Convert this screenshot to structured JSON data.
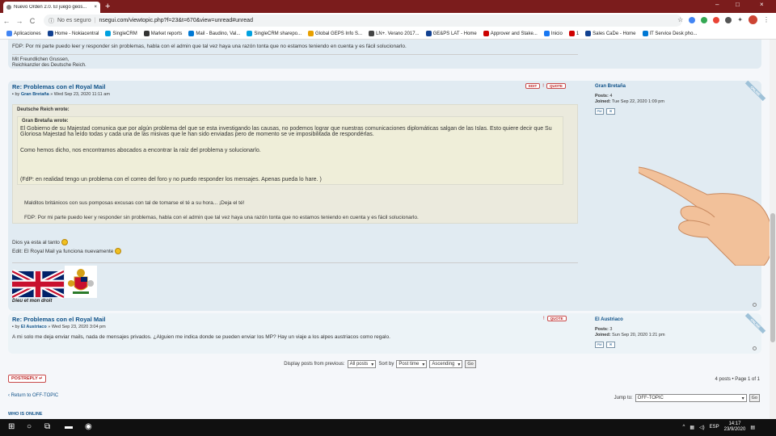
{
  "browser": {
    "tab_title": "Nuevo Orden 2.0. El juego geos...",
    "tab_close": "×",
    "new_tab": "+",
    "window_min": "–",
    "window_max": "□",
    "window_close": "×",
    "nav_back": "←",
    "nav_forward": "→",
    "nav_reload": "C",
    "security": "No es seguro",
    "url": "nsegui.com/viewtopic.php?f=23&t=670&view=unread#unread",
    "bookmarks": [
      {
        "label": "Aplicaciones",
        "color": "#4285f4"
      },
      {
        "label": "Home - Nokiacentral",
        "color": "#124191"
      },
      {
        "label": "SingleCRM",
        "color": "#00a1e0"
      },
      {
        "label": "Market reports",
        "color": "#333333"
      },
      {
        "label": "Mail - Baudino, Val...",
        "color": "#0078d4"
      },
      {
        "label": "SingleCRM sharepo...",
        "color": "#00a1e0"
      },
      {
        "label": "Global GEPS Info S...",
        "color": "#e8a000"
      },
      {
        "label": "LN+. Verano 2017...",
        "color": "#444444"
      },
      {
        "label": "GE&PS LAT - Home",
        "color": "#124191"
      },
      {
        "label": "Approver and Stake...",
        "color": "#cc0000"
      },
      {
        "label": "Inicio",
        "color": "#1877f2"
      },
      {
        "label": "1",
        "color": "#d00000"
      },
      {
        "label": "Sales CaDe - Home",
        "color": "#124191"
      },
      {
        "label": "IT Service Desk pho...",
        "color": "#0078d4"
      }
    ]
  },
  "prev_post": {
    "fdp": "FDP: Por mi parte puedo leer y responder sin problemas, habla con el admin que tal vez haya una razón tonta que no estamos teniendo en cuenta y es fácil solucionarlo.",
    "sig1": "Mit Freundlichen Grussen,",
    "sig2": "Reichkanzler des Deutsche Reich."
  },
  "post1": {
    "title": "Re: Problemas con el Royal Mail",
    "author": "Gran Bretaña",
    "author_prefix": "by",
    "date": "» Wed Sep 23, 2020 11:11 am",
    "edit_btn": "EDIT",
    "warn_icon": "!",
    "quote_btn": "QUOTE",
    "outer_cite": "Deutsche Reich wrote:",
    "inner_cite": "Gran Bretaña wrote:",
    "inner_p1": "El Gobierno de su Majestad comunica que por algún problema del que se esta investigando las causas, no podemos lograr que nuestras comunicaciones diplomáticas salgan de las Islas. Esto quiere decir que Su Gloriosa Majestad ha leído todas y cada una de las misivas que le han sido enviadas pero de momento se ve imposibilitada de respondérlas.",
    "inner_p2": "Como hemos dicho, nos encontramos abocados a encontrar la raíz del problema y solucionarlo.",
    "inner_p3": "(FdP: en realidad tengo un problema con el correo del foro y no puedo responder los mensajes. Apenas pueda lo hare. )",
    "outer_p1": "Malditos británicos con sus pomposas excusas con tal de tomarse el té a su hora... ¡Deja el té!",
    "outer_p2": "FDP: Por mi parte puedo leer y responder sin problemas, habla con el admin que tal vez haya una razón tonta que no estamos teniendo en cuenta y es fácil solucionarlo.",
    "reply1": "Dios ya esta al tanto",
    "reply2": "Edit: El Royal Mail ya funciona nuevamente",
    "signature": "Dieu et mon droit",
    "profile_name": "Gran Bretaña",
    "posts_label": "Posts:",
    "posts": "4",
    "joined_label": "Joined:",
    "joined": "Tue Sep 22, 2020 1:09 pm",
    "online": "ONLINE",
    "pm_label": "PM",
    "mail_label": "✉"
  },
  "post2": {
    "title": "Re: Problemas con el Royal Mail",
    "author": "El Austriaco",
    "author_prefix": "by",
    "date": "» Wed Sep 23, 2020 3:04 pm",
    "warn_icon": "!",
    "quote_btn": "QUOTE",
    "body": "A mi solo me deja enviar mails, nada de mensajes privados. ¿Alguien me indica donde se pueden enviar los MP? Hay un viaje a los alpes austriacos como regalo.",
    "profile_name": "El Austriaco",
    "posts_label": "Posts:",
    "posts": "3",
    "joined_label": "Joined:",
    "joined": "Sun Sep 20, 2020 1:21 pm",
    "online": "ONLINE",
    "pm_label": "PM",
    "mail_label": "✉"
  },
  "controls": {
    "display_label": "Display posts from previous:",
    "display_value": "All posts",
    "sort_label": "Sort by",
    "sort_value": "Post time",
    "order_value": "Ascending",
    "go": "Go",
    "post_reply": "POSTREPLY",
    "reply_icon": "↵",
    "pagination": "4 posts • Page 1 of 1",
    "return_link": "‹ Return to OFF-TOPIC",
    "jump_label": "Jump to:",
    "jump_value": "OFF-TOPIC",
    "whos_online": "WHO IS ONLINE"
  },
  "taskbar": {
    "lang": "ESP",
    "time": "14:17",
    "date": "23/9/2020"
  },
  "colors": {
    "tabbar": "#7b1c1c",
    "post_bg": "#e1ebf2",
    "post_alt_bg": "#ecf3f7",
    "link": "#105289",
    "button_border": "#c94a4a"
  }
}
